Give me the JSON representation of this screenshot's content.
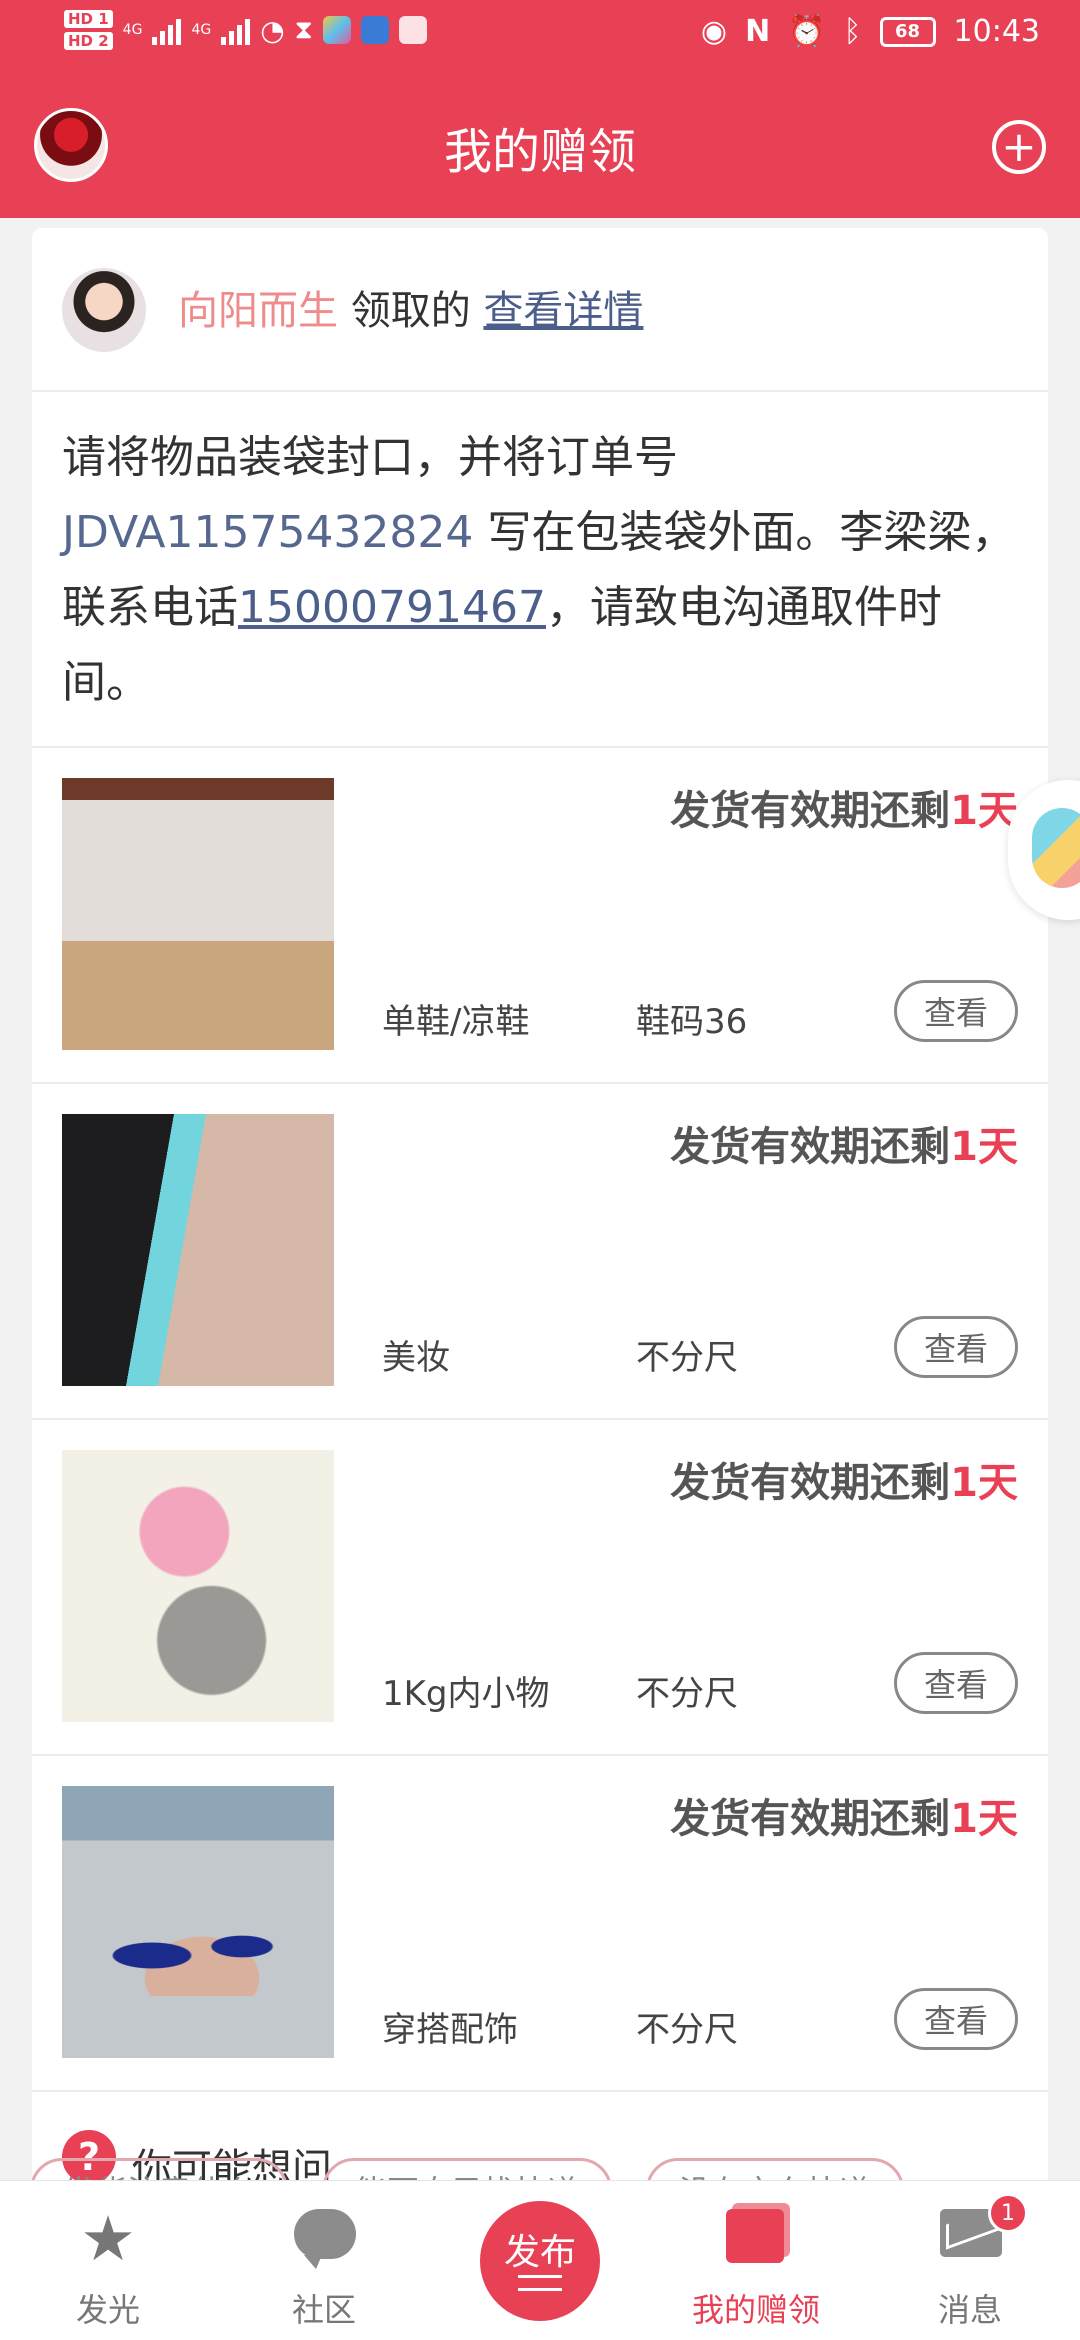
{
  "status_bar": {
    "hd1": "HD 1",
    "hd2": "HD 2",
    "net1": "4G",
    "net2": "4G",
    "battery": "68",
    "time": "10:43"
  },
  "header": {
    "title": "我的赠领"
  },
  "giver": {
    "name": "向阳而生",
    "action": " 领取的 ",
    "detail_link": "查看详情"
  },
  "notice": {
    "text_before": "请将物品装袋封口，并将订单号 ",
    "order_no": "JDVA11575432824",
    "text_middle": " 写在包装袋外面。李梁梁，联系电话",
    "phone": "15000791467",
    "text_after": "，请致电沟通取件时间。"
  },
  "items": [
    {
      "deadline_prefix": "发货有效期还剩",
      "deadline_days": "1天",
      "category": "单鞋/凉鞋",
      "size": "鞋码36",
      "button": "查看"
    },
    {
      "deadline_prefix": "发货有效期还剩",
      "deadline_days": "1天",
      "category": "美妆",
      "size": "不分尺",
      "button": "查看"
    },
    {
      "deadline_prefix": "发货有效期还剩",
      "deadline_days": "1天",
      "category": "1Kg内小物",
      "size": "不分尺",
      "button": "查看"
    },
    {
      "deadline_prefix": "发货有效期还剩",
      "deadline_days": "1天",
      "category": "穿搭配饰",
      "size": "不分尺",
      "button": "查看"
    }
  ],
  "faq": {
    "icon_text": "?",
    "label": "你可能想问",
    "chips": [
      "发货注意什么",
      "能否自己找快递",
      "没有京东快递"
    ]
  },
  "nav": {
    "tabs": [
      {
        "label": "发光",
        "icon": "star-icon"
      },
      {
        "label": "社区",
        "icon": "chat-icon"
      },
      {
        "label": "发布",
        "icon": "publish-icon"
      },
      {
        "label": "我的赠领",
        "icon": "book-icon"
      },
      {
        "label": "消息",
        "icon": "mail-icon"
      }
    ],
    "message_badge": "1"
  },
  "colors": {
    "accent": "#e84055",
    "link": "#4c5f8a"
  }
}
